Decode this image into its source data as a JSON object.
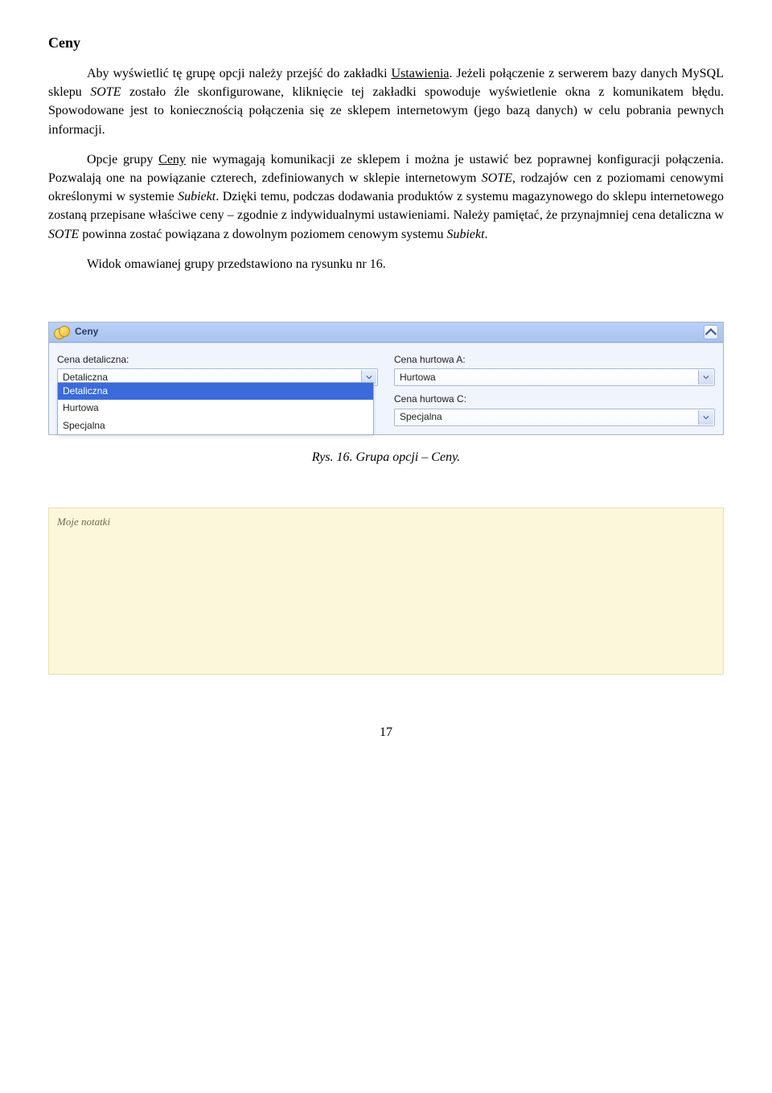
{
  "heading": "Ceny",
  "para1_a": "Aby wyświetlić tę grupę opcji należy przejść do zakładki ",
  "para1_link": "Ustawienia",
  "para1_b": ". Jeżeli połączenie z serwerem bazy danych MySQL sklepu ",
  "para1_i1": "SOTE",
  "para1_c": " zostało źle skonfigurowane, kliknięcie tej zakładki spowoduje wyświetlenie okna z komunikatem błędu. Spowodowane jest to koniecznością połączenia się ze sklepem internetowym (jego bazą danych) w celu pobrania pewnych informacji.",
  "para2_a": "Opcje grupy ",
  "para2_u": "Ceny",
  "para2_b": " nie wymagają komunikacji ze sklepem i można je ustawić bez poprawnej konfiguracji połączenia. Pozwalają one na powiązanie czterech, zdefiniowanych w sklepie internetowym ",
  "para2_i1": "SOTE",
  "para2_c": ", rodzajów cen z poziomami cenowymi określonymi w systemie ",
  "para2_i2": "Subiekt",
  "para2_d": ". Dzięki temu, podczas dodawania produktów z systemu magazynowego do sklepu internetowego zostaną przepisane właściwe ceny – zgodnie z indywidualnymi ustawieniami. Należy pamiętać, że przynajmniej cena detaliczna w ",
  "para2_i3": "SOTE",
  "para2_e": " powinna zostać powiązana z dowolnym poziomem cenowym systemu ",
  "para2_i4": "Subiekt",
  "para2_f": ".",
  "para3": "Widok omawianej grupy przedstawiono na rysunku nr 16.",
  "panel": {
    "title": "Ceny",
    "labels": {
      "retail": "Cena detaliczna:",
      "wholesaleA": "Cena hurtowa A:",
      "wholesaleC": "Cena hurtowa C:"
    },
    "combos": {
      "retail": "Detaliczna",
      "wholesaleA": "Hurtowa",
      "wholesaleC": "Specjalna"
    },
    "dropdown_options": [
      "Detaliczna",
      "Hurtowa",
      "Specjalna"
    ],
    "dropdown_selected_index": 0
  },
  "caption": "Rys. 16. Grupa opcji – Ceny.",
  "notes_title": "Moje notatki",
  "page_number": "17"
}
